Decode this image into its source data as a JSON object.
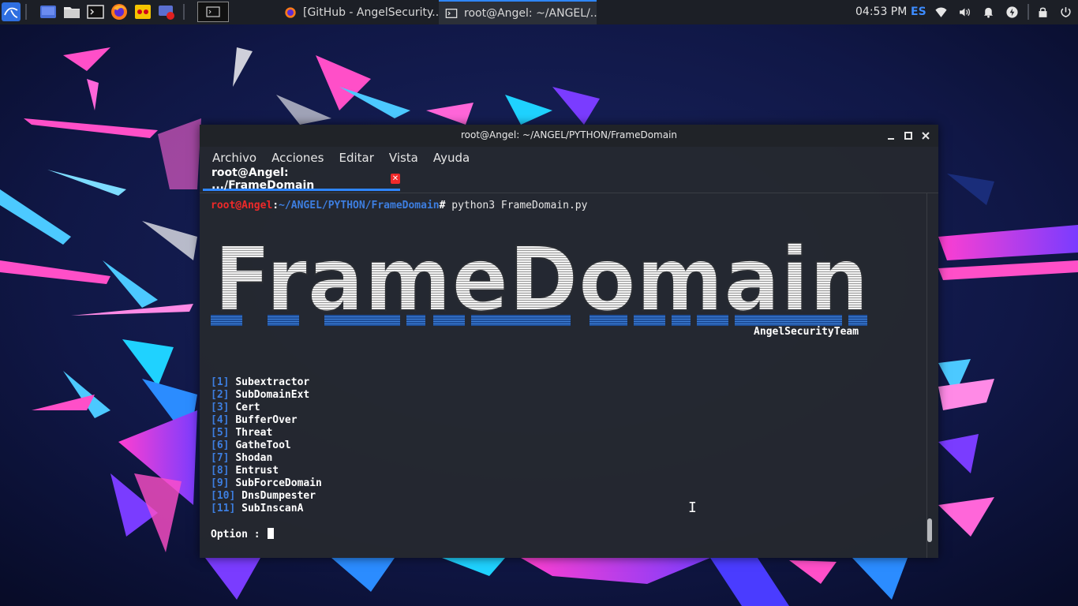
{
  "panel": {
    "launchers": [
      "kali-menu-icon",
      "show-desktop-icon",
      "file-manager-icon",
      "terminal-icon",
      "firefox-icon",
      "app-icon",
      "screen-recorder-icon"
    ],
    "tasks": [
      {
        "label": "[GitHub - AngelSecurity...",
        "icon": "firefox-icon",
        "active": false
      },
      {
        "label": "root@Angel: ~/ANGEL/...",
        "icon": "terminal-icon",
        "active": true
      }
    ],
    "clock": "04:53 PM",
    "lang": "ES",
    "tray_icons": [
      "network-icon",
      "volume-icon",
      "notifications-icon",
      "power-manager-icon",
      "lock-icon",
      "power-icon"
    ]
  },
  "window": {
    "title": "root@Angel: ~/ANGEL/PYTHON/FrameDomain",
    "menu": [
      "Archivo",
      "Acciones",
      "Editar",
      "Vista",
      "Ayuda"
    ],
    "tab_label": "root@Angel: .../FrameDomain"
  },
  "terminal": {
    "prompt_user": "root@Angel",
    "prompt_colon": ":",
    "prompt_path": "~/ANGEL/PYTHON/FrameDomain",
    "prompt_hash": "#",
    "command": " python3 FrameDomain.py",
    "banner": "FrameDomain",
    "team": "AngelSecurityTeam",
    "options": [
      {
        "n": "1",
        "name": "Subextractor"
      },
      {
        "n": "2",
        "name": "SubDomainExt"
      },
      {
        "n": "3",
        "name": "Cert"
      },
      {
        "n": "4",
        "name": "BufferOver"
      },
      {
        "n": "5",
        "name": "Threat"
      },
      {
        "n": "6",
        "name": "GatheTool"
      },
      {
        "n": "7",
        "name": "Shodan"
      },
      {
        "n": "8",
        "name": "Entrust"
      },
      {
        "n": "9",
        "name": "SubForceDomain"
      },
      {
        "n": "10",
        "name": "DnsDumpester"
      },
      {
        "n": "11",
        "name": "SubInscanA"
      }
    ],
    "option_prompt": "Option : "
  },
  "colors": {
    "accent": "#2f86ff",
    "prompt_red": "#ef2929",
    "prompt_blue": "#3d7ee0",
    "panel_bg": "#1c1f26"
  }
}
